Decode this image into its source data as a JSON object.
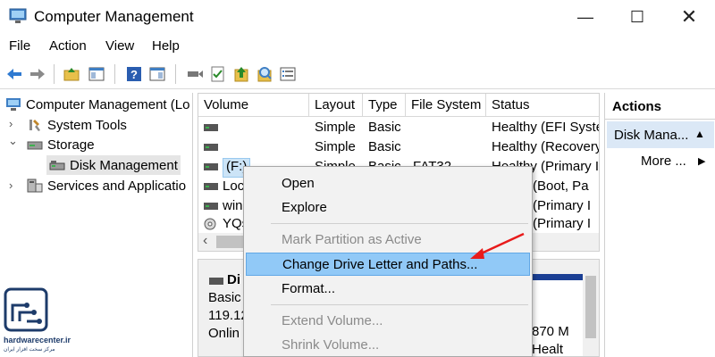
{
  "window": {
    "title": "Computer Management",
    "minimize_glyph": "—",
    "maximize_glyph": "☐",
    "close_glyph": "✕"
  },
  "menu": [
    "File",
    "Action",
    "View",
    "Help"
  ],
  "toolbar_icons": [
    "back-icon",
    "forward-icon",
    "up-folder-icon",
    "show-hide-tree-icon",
    "help-icon",
    "properties-icon",
    "connect-icon",
    "check-icon",
    "up-arrow-icon",
    "search-icon",
    "list-icon"
  ],
  "tree": {
    "root": "Computer Management (Lo",
    "system_tools": "System Tools",
    "storage": "Storage",
    "disk_management": "Disk Management",
    "services": "Services and Applicatio",
    "chevron_right": "›",
    "chevron_down": "⌄"
  },
  "volume_table": {
    "columns": [
      "Volume",
      "Layout",
      "Type",
      "File System",
      "Status"
    ],
    "rows": [
      {
        "volume": "",
        "layout": "Simple",
        "type": "Basic",
        "fs": "",
        "status": "Healthy (EFI Syste"
      },
      {
        "volume": "",
        "layout": "Simple",
        "type": "Basic",
        "fs": "",
        "status": "Healthy (Recovery"
      },
      {
        "volume": "(F:)",
        "layout": "Simple",
        "type": "Basic",
        "fs": "FAT32",
        "status": "Healthy (Primary I"
      },
      {
        "volume": "Loc",
        "layout": "",
        "type": "",
        "fs": "",
        "status": "(Boot, Pa"
      },
      {
        "volume": "win",
        "layout": "",
        "type": "",
        "fs": "",
        "status": "(Primary I"
      },
      {
        "volume": "YQs",
        "layout": "",
        "type": "",
        "fs": "",
        "status": "(Primary I"
      }
    ],
    "scroll_left_glyph": "‹"
  },
  "disk_panel": {
    "name": "Di",
    "type": "Basic",
    "size": "119.12",
    "state": "Onlin",
    "partition_size": "870 M",
    "partition_status": "Healt"
  },
  "actions": {
    "title": "Actions",
    "section": "Disk Mana...",
    "section_glyph": "▲",
    "more": "More ...",
    "more_glyph": "▶"
  },
  "context_menu": {
    "items": [
      {
        "label": "Open",
        "enabled": true
      },
      {
        "label": "Explore",
        "enabled": true
      },
      {
        "label": "Mark Partition as Active",
        "enabled": false
      },
      {
        "label": "Change Drive Letter and Paths...",
        "enabled": true,
        "highlighted": true
      },
      {
        "label": "Format...",
        "enabled": true
      },
      {
        "label": "Extend Volume...",
        "enabled": false
      },
      {
        "label": "Shrink Volume...",
        "enabled": false
      }
    ]
  },
  "watermark": {
    "brand": "hardwarecenter.ir",
    "tagline": "مرکز سخت افزار ایران"
  },
  "colors": {
    "highlight": "#91c9f7",
    "selection": "#cce4f7",
    "arrow": "#e81b1b",
    "partition_bar": "#1b3f94"
  }
}
